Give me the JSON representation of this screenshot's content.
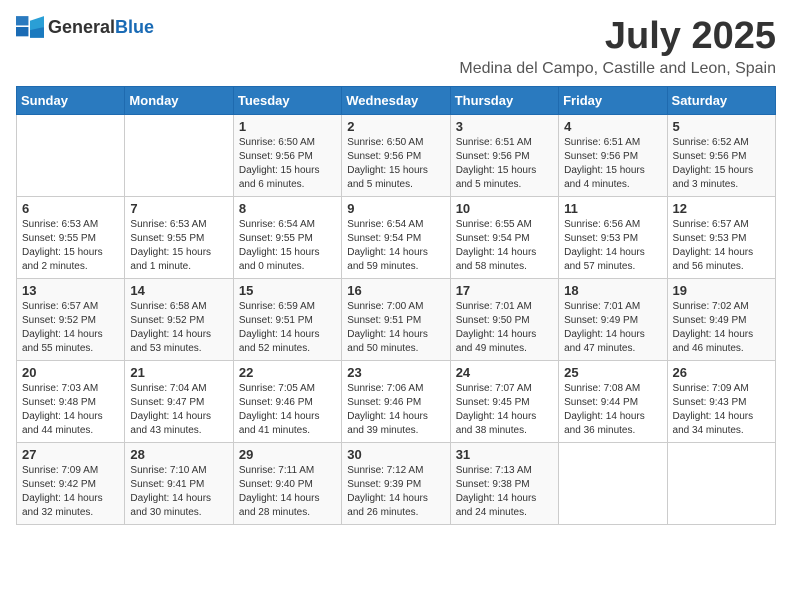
{
  "header": {
    "logo_general": "General",
    "logo_blue": "Blue",
    "month_year": "July 2025",
    "location": "Medina del Campo, Castille and Leon, Spain"
  },
  "weekdays": [
    "Sunday",
    "Monday",
    "Tuesday",
    "Wednesday",
    "Thursday",
    "Friday",
    "Saturday"
  ],
  "weeks": [
    [
      {
        "day": "",
        "sunrise": "",
        "sunset": "",
        "daylight": ""
      },
      {
        "day": "",
        "sunrise": "",
        "sunset": "",
        "daylight": ""
      },
      {
        "day": "1",
        "sunrise": "Sunrise: 6:50 AM",
        "sunset": "Sunset: 9:56 PM",
        "daylight": "Daylight: 15 hours and 6 minutes."
      },
      {
        "day": "2",
        "sunrise": "Sunrise: 6:50 AM",
        "sunset": "Sunset: 9:56 PM",
        "daylight": "Daylight: 15 hours and 5 minutes."
      },
      {
        "day": "3",
        "sunrise": "Sunrise: 6:51 AM",
        "sunset": "Sunset: 9:56 PM",
        "daylight": "Daylight: 15 hours and 5 minutes."
      },
      {
        "day": "4",
        "sunrise": "Sunrise: 6:51 AM",
        "sunset": "Sunset: 9:56 PM",
        "daylight": "Daylight: 15 hours and 4 minutes."
      },
      {
        "day": "5",
        "sunrise": "Sunrise: 6:52 AM",
        "sunset": "Sunset: 9:56 PM",
        "daylight": "Daylight: 15 hours and 3 minutes."
      }
    ],
    [
      {
        "day": "6",
        "sunrise": "Sunrise: 6:53 AM",
        "sunset": "Sunset: 9:55 PM",
        "daylight": "Daylight: 15 hours and 2 minutes."
      },
      {
        "day": "7",
        "sunrise": "Sunrise: 6:53 AM",
        "sunset": "Sunset: 9:55 PM",
        "daylight": "Daylight: 15 hours and 1 minute."
      },
      {
        "day": "8",
        "sunrise": "Sunrise: 6:54 AM",
        "sunset": "Sunset: 9:55 PM",
        "daylight": "Daylight: 15 hours and 0 minutes."
      },
      {
        "day": "9",
        "sunrise": "Sunrise: 6:54 AM",
        "sunset": "Sunset: 9:54 PM",
        "daylight": "Daylight: 14 hours and 59 minutes."
      },
      {
        "day": "10",
        "sunrise": "Sunrise: 6:55 AM",
        "sunset": "Sunset: 9:54 PM",
        "daylight": "Daylight: 14 hours and 58 minutes."
      },
      {
        "day": "11",
        "sunrise": "Sunrise: 6:56 AM",
        "sunset": "Sunset: 9:53 PM",
        "daylight": "Daylight: 14 hours and 57 minutes."
      },
      {
        "day": "12",
        "sunrise": "Sunrise: 6:57 AM",
        "sunset": "Sunset: 9:53 PM",
        "daylight": "Daylight: 14 hours and 56 minutes."
      }
    ],
    [
      {
        "day": "13",
        "sunrise": "Sunrise: 6:57 AM",
        "sunset": "Sunset: 9:52 PM",
        "daylight": "Daylight: 14 hours and 55 minutes."
      },
      {
        "day": "14",
        "sunrise": "Sunrise: 6:58 AM",
        "sunset": "Sunset: 9:52 PM",
        "daylight": "Daylight: 14 hours and 53 minutes."
      },
      {
        "day": "15",
        "sunrise": "Sunrise: 6:59 AM",
        "sunset": "Sunset: 9:51 PM",
        "daylight": "Daylight: 14 hours and 52 minutes."
      },
      {
        "day": "16",
        "sunrise": "Sunrise: 7:00 AM",
        "sunset": "Sunset: 9:51 PM",
        "daylight": "Daylight: 14 hours and 50 minutes."
      },
      {
        "day": "17",
        "sunrise": "Sunrise: 7:01 AM",
        "sunset": "Sunset: 9:50 PM",
        "daylight": "Daylight: 14 hours and 49 minutes."
      },
      {
        "day": "18",
        "sunrise": "Sunrise: 7:01 AM",
        "sunset": "Sunset: 9:49 PM",
        "daylight": "Daylight: 14 hours and 47 minutes."
      },
      {
        "day": "19",
        "sunrise": "Sunrise: 7:02 AM",
        "sunset": "Sunset: 9:49 PM",
        "daylight": "Daylight: 14 hours and 46 minutes."
      }
    ],
    [
      {
        "day": "20",
        "sunrise": "Sunrise: 7:03 AM",
        "sunset": "Sunset: 9:48 PM",
        "daylight": "Daylight: 14 hours and 44 minutes."
      },
      {
        "day": "21",
        "sunrise": "Sunrise: 7:04 AM",
        "sunset": "Sunset: 9:47 PM",
        "daylight": "Daylight: 14 hours and 43 minutes."
      },
      {
        "day": "22",
        "sunrise": "Sunrise: 7:05 AM",
        "sunset": "Sunset: 9:46 PM",
        "daylight": "Daylight: 14 hours and 41 minutes."
      },
      {
        "day": "23",
        "sunrise": "Sunrise: 7:06 AM",
        "sunset": "Sunset: 9:46 PM",
        "daylight": "Daylight: 14 hours and 39 minutes."
      },
      {
        "day": "24",
        "sunrise": "Sunrise: 7:07 AM",
        "sunset": "Sunset: 9:45 PM",
        "daylight": "Daylight: 14 hours and 38 minutes."
      },
      {
        "day": "25",
        "sunrise": "Sunrise: 7:08 AM",
        "sunset": "Sunset: 9:44 PM",
        "daylight": "Daylight: 14 hours and 36 minutes."
      },
      {
        "day": "26",
        "sunrise": "Sunrise: 7:09 AM",
        "sunset": "Sunset: 9:43 PM",
        "daylight": "Daylight: 14 hours and 34 minutes."
      }
    ],
    [
      {
        "day": "27",
        "sunrise": "Sunrise: 7:09 AM",
        "sunset": "Sunset: 9:42 PM",
        "daylight": "Daylight: 14 hours and 32 minutes."
      },
      {
        "day": "28",
        "sunrise": "Sunrise: 7:10 AM",
        "sunset": "Sunset: 9:41 PM",
        "daylight": "Daylight: 14 hours and 30 minutes."
      },
      {
        "day": "29",
        "sunrise": "Sunrise: 7:11 AM",
        "sunset": "Sunset: 9:40 PM",
        "daylight": "Daylight: 14 hours and 28 minutes."
      },
      {
        "day": "30",
        "sunrise": "Sunrise: 7:12 AM",
        "sunset": "Sunset: 9:39 PM",
        "daylight": "Daylight: 14 hours and 26 minutes."
      },
      {
        "day": "31",
        "sunrise": "Sunrise: 7:13 AM",
        "sunset": "Sunset: 9:38 PM",
        "daylight": "Daylight: 14 hours and 24 minutes."
      },
      {
        "day": "",
        "sunrise": "",
        "sunset": "",
        "daylight": ""
      },
      {
        "day": "",
        "sunrise": "",
        "sunset": "",
        "daylight": ""
      }
    ]
  ]
}
